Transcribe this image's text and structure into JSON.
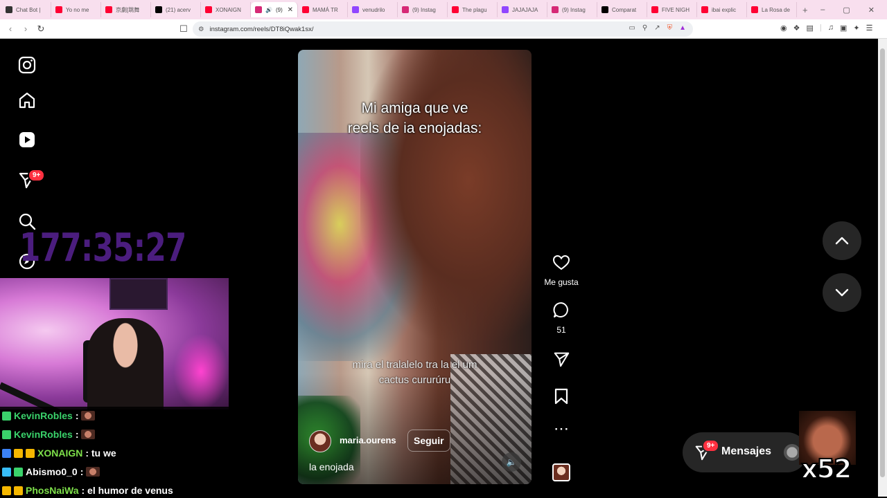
{
  "browser": {
    "tabs": [
      {
        "title": "Chat Bot |",
        "color": "#333333"
      },
      {
        "title": "Yo no me",
        "color": "#ff0033"
      },
      {
        "title": "京劇[跳舞",
        "color": "#ff0033"
      },
      {
        "title": "(21) acerv",
        "color": "#000000"
      },
      {
        "title": "XONAIGN",
        "color": "#ff0033"
      },
      {
        "title": "(9)",
        "color": "#d62976",
        "active": true
      },
      {
        "title": "MAMÁ TR",
        "color": "#ff0033"
      },
      {
        "title": "venudrilo",
        "color": "#9146ff"
      },
      {
        "title": "(9) Instag",
        "color": "#d62976"
      },
      {
        "title": "The plagu",
        "color": "#ff0033"
      },
      {
        "title": "JAJAJAJA",
        "color": "#9146ff"
      },
      {
        "title": "(9) Instag",
        "color": "#d62976"
      },
      {
        "title": "Comparat",
        "color": "#000000"
      },
      {
        "title": "FIVE NIGH",
        "color": "#ff0033"
      },
      {
        "title": "ibai explic",
        "color": "#ff0033"
      },
      {
        "title": "La Rosa de",
        "color": "#ff0033"
      }
    ],
    "new_tab_label": "+",
    "window_controls": {
      "minimize": "–",
      "maximize": "▢",
      "close": "✕"
    },
    "url": "instagram.com/reels/DT8iQwak1sx/"
  },
  "sidebar": {
    "notifications_badge": "9+",
    "icons": [
      "instagram-logo-icon",
      "home-icon",
      "reels-icon",
      "messages-icon",
      "search-icon",
      "explore-icon"
    ]
  },
  "overlay": {
    "timer": "177:35:27",
    "meme_count": "x52"
  },
  "reel": {
    "caption_line1": "Mi amiga que ve",
    "caption_line2": "reels de ia enojadas:",
    "subtitle_line1": "mira el tralalelo tra la el um",
    "subtitle_line2": "cactus cururúru",
    "username": "maria.ourens",
    "follow_label": "Seguir",
    "description": "la enojada"
  },
  "actions": {
    "like_label": "Me gusta",
    "comment_count": "51"
  },
  "messages": {
    "label": "Mensajes",
    "badge": "9+"
  },
  "chat": [
    {
      "user": "KevinRobles",
      "text": ":",
      "user_color": "#3ad36b",
      "badges": [
        "#3ad36b"
      ],
      "emote": true
    },
    {
      "user": "KevinRobles",
      "text": ":",
      "user_color": "#3ad36b",
      "badges": [
        "#3ad36b"
      ],
      "emote": true
    },
    {
      "user": "XONAIGN",
      "text": ": tu we",
      "user_color": "#7ee04a",
      "badges": [
        "#3b82f6",
        "#f5b700",
        "#f5b700"
      ],
      "emote": false
    },
    {
      "user": "Abismo0_0",
      "text": ":",
      "user_color": "#ffffff",
      "badges": [
        "#38bdf8",
        "#3ad36b"
      ],
      "emote": true
    },
    {
      "user": "PhosNaiWa",
      "text": ": el humor de venus",
      "user_color": "#7ee04a",
      "badges": [
        "#f5b700",
        "#f5b700"
      ],
      "emote": false
    }
  ]
}
